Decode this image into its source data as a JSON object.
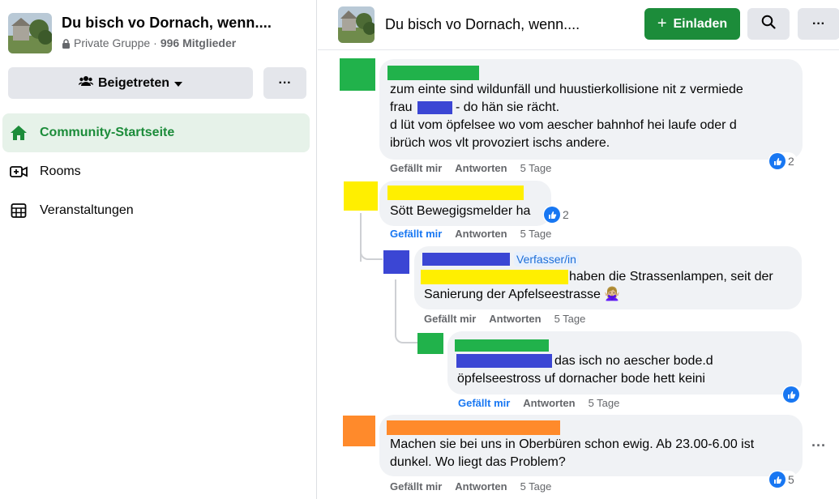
{
  "group": {
    "title": "Du bisch vo Dornach, wenn....",
    "privacy": "Private Gruppe",
    "separator": "·",
    "members": "996 Mitglieder",
    "joined_label": "Beigetreten",
    "more_label": "···"
  },
  "nav": {
    "items": [
      {
        "label": "Community-Startseite",
        "icon": "home-icon"
      },
      {
        "label": "Rooms",
        "icon": "rooms-icon"
      },
      {
        "label": "Veranstaltungen",
        "icon": "calendar-icon"
      }
    ]
  },
  "header": {
    "title": "Du bisch vo Dornach, wenn....",
    "invite_label": "Einladen",
    "invite_plus": "+",
    "more_label": "···"
  },
  "colors": {
    "brand_green": "#1c8c3a",
    "like_blue": "#1877f2",
    "redact_green": "#21b24b",
    "redact_yellow": "#ffef00",
    "redact_blue": "#3b46d4",
    "redact_orange": "#ff8a2b"
  },
  "comments": [
    {
      "lines": [
        "zum einte sind wildunfäll und huustierkollisione nit z vermiede",
        "frau",
        "- do hän sie rächt.",
        "d lüt vom öpfelsee wo vom aescher bahnhof hei laufe oder d",
        "ibrüch wos vlt provoziert ischs andere."
      ],
      "reactions": "2",
      "like": "Gefällt mir",
      "reply": "Antworten",
      "time": "5 Tage"
    },
    {
      "lines": [
        "Sött Bewegigsmelder ha"
      ],
      "reactions": "2",
      "like": "Gefällt mir",
      "reply": "Antworten",
      "time": "5 Tage"
    },
    {
      "author_tag": "Verfasser/in",
      "lines": [
        "haben die Strassenlampen, seit der",
        "Sanierung der Apfelseestrasse 🙅🏼‍♀️"
      ],
      "like": "Gefällt mir",
      "reply": "Antworten",
      "time": "5 Tage"
    },
    {
      "lines": [
        "das isch no aescher bode.d",
        "öpfelseestross uf dornacher bode hett keini"
      ],
      "like": "Gefällt mir",
      "reply": "Antworten",
      "time": "5 Tage"
    },
    {
      "lines": [
        "Machen sie bei uns in Oberbüren schon ewig. Ab 23.00-6.00 ist",
        "dunkel. Wo liegt das Problem?"
      ],
      "reactions": "5",
      "like": "Gefällt mir",
      "reply": "Antworten",
      "time": "5 Tage",
      "more_label": "···"
    }
  ]
}
